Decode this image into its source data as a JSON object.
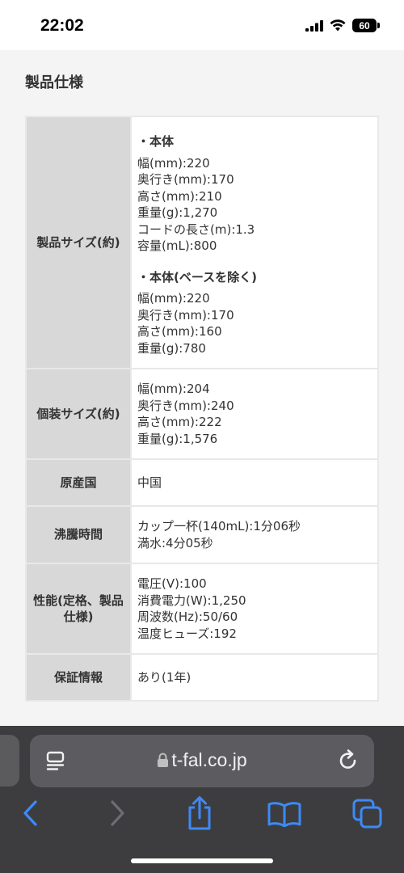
{
  "status_bar": {
    "time": "22:02",
    "battery": "60"
  },
  "page": {
    "section_title": "製品仕様",
    "rows": [
      {
        "label": "製品サイズ(約)",
        "groups": [
          {
            "heading": "・本体",
            "lines": [
              "幅(mm):220",
              "奥行き(mm):170",
              "高さ(mm):210",
              "重量(g):1,270",
              "コードの長さ(m):1.3",
              "容量(mL):800"
            ]
          },
          {
            "heading": "・本体(ベースを除く)",
            "lines": [
              "幅(mm):220",
              "奥行き(mm):170",
              "高さ(mm):160",
              "重量(g):780"
            ]
          }
        ]
      },
      {
        "label": "個装サイズ(約)",
        "lines": [
          "幅(mm):204",
          "奥行き(mm):240",
          "高さ(mm):222",
          "重量(g):1,576"
        ]
      },
      {
        "label": "原産国",
        "lines": [
          "中国"
        ]
      },
      {
        "label": "沸騰時間",
        "lines": [
          "カップ一杯(140mL):1分06秒",
          "満水:4分05秒"
        ]
      },
      {
        "label": "性能(定格、製品仕様)",
        "lines": [
          "電圧(V):100",
          "消費電力(W):1,250",
          "周波数(Hz):50/60",
          "温度ヒューズ:192"
        ]
      },
      {
        "label": "保証情報",
        "lines": [
          "あり(1年)"
        ]
      }
    ]
  },
  "browser": {
    "url": "t-fal.co.jp"
  },
  "colors": {
    "accent": "#3d8af7",
    "toolbar": "#3d3d3f",
    "url_pill": "#5c5c60"
  }
}
